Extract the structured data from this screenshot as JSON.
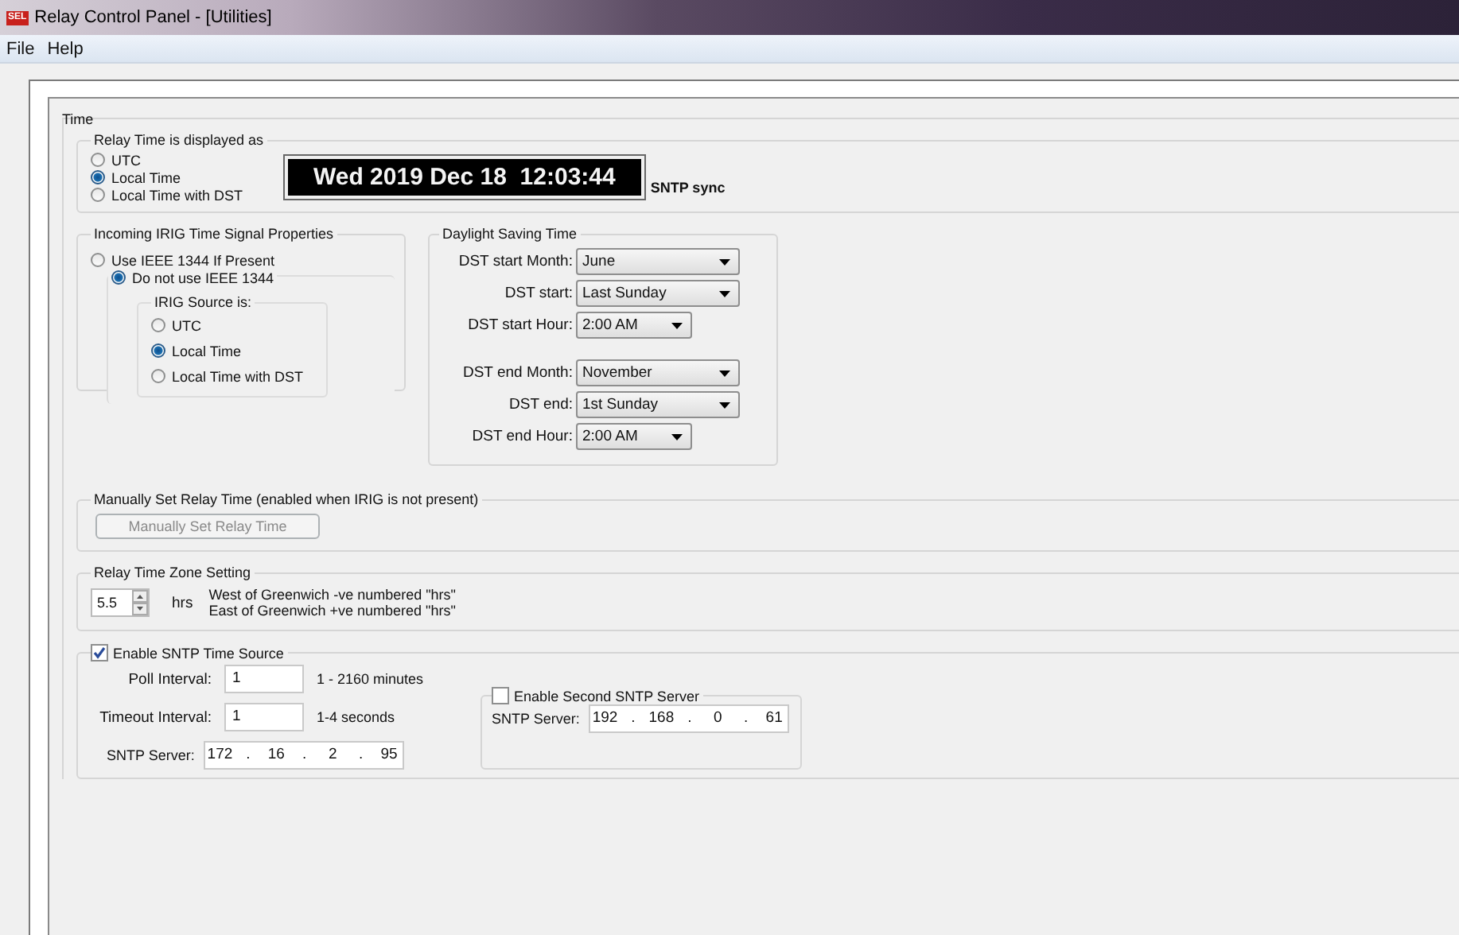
{
  "window": {
    "logo": "SEL",
    "title": "Relay Control Panel - [Utilities]"
  },
  "menu": [
    {
      "label": "File"
    },
    {
      "label": "Help"
    }
  ],
  "time_group": {
    "title": "Time"
  },
  "display_group": {
    "title": "Relay Time is displayed as",
    "options": [
      {
        "label": "UTC",
        "selected": false
      },
      {
        "label": "Local Time",
        "selected": true
      },
      {
        "label": "Local Time with DST",
        "selected": false
      }
    ],
    "clock": "Wed 2019 Dec 18  12:03:44",
    "sync_label": "SNTP sync"
  },
  "irig_group": {
    "title": "Incoming IRIG Time Signal Properties",
    "options": [
      {
        "label": "Use IEEE 1344 If Present",
        "selected": false
      },
      {
        "label": "Do not use IEEE 1344",
        "selected": true
      }
    ],
    "source": {
      "title": "IRIG Source is:",
      "options": [
        {
          "label": "UTC",
          "selected": false
        },
        {
          "label": "Local Time",
          "selected": true
        },
        {
          "label": "Local Time with DST",
          "selected": false
        }
      ]
    }
  },
  "dst_group": {
    "title": "Daylight Saving Time",
    "start_fields": [
      {
        "label": "DST start Month:",
        "value": "June",
        "kind": "wide"
      },
      {
        "label": "DST start:",
        "value": "Last Sunday",
        "kind": "wide"
      },
      {
        "label": "DST start Hour:",
        "value": "2:00 AM",
        "kind": "narrow"
      }
    ],
    "end_fields": [
      {
        "label": "DST end Month:",
        "value": "November",
        "kind": "wide"
      },
      {
        "label": "DST end:",
        "value": "1st Sunday",
        "kind": "wide"
      },
      {
        "label": "DST end Hour:",
        "value": "2:00 AM",
        "kind": "narrow"
      }
    ]
  },
  "manual_group": {
    "title": "Manually Set Relay Time (enabled when IRIG is not present)",
    "button": {
      "label": "Manually Set Relay Time",
      "disabled": true
    }
  },
  "timezone_group": {
    "title": "Relay Time Zone Setting",
    "value": "5.5",
    "unit": "hrs",
    "notes": [
      "West of Greenwich -ve numbered \"hrs\"",
      "East of Greenwich +ve numbered \"hrs\""
    ]
  },
  "sntp_group": {
    "title": "Enable SNTP Time Source",
    "checked": true,
    "poll": {
      "label": "Poll Interval:",
      "value": "1",
      "hint": "1 - 2160 minutes"
    },
    "timeout": {
      "label": "Timeout Interval:",
      "value": "1",
      "hint": "1-4 seconds"
    },
    "server": {
      "label": "SNTP Server:",
      "octets": [
        "172",
        "16",
        "2",
        "95"
      ],
      "separator": "."
    },
    "second": {
      "title": "Enable Second SNTP Server",
      "checked": false,
      "server": {
        "label": "SNTP Server:",
        "octets": [
          "192",
          "168",
          "0",
          "61"
        ],
        "separator": "."
      }
    }
  }
}
